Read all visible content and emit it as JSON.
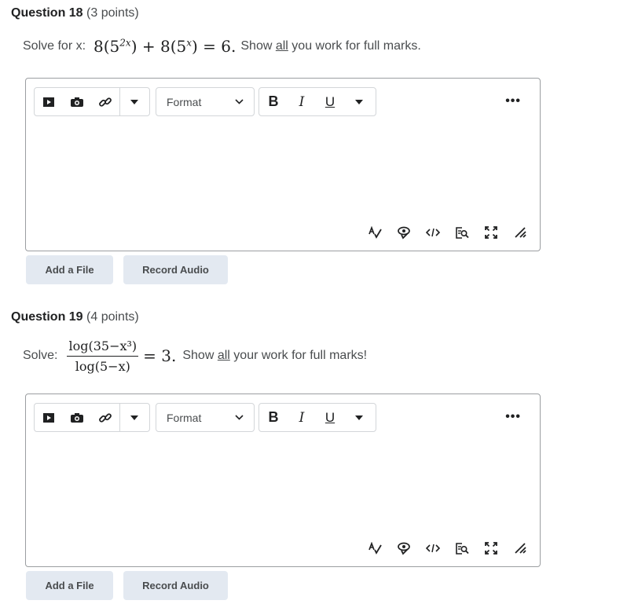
{
  "questions": [
    {
      "label": "Question 18",
      "points": "(3 points)",
      "prompt_prefix": "Solve for x:",
      "math": {
        "c1": "8(5",
        "e1": "2x",
        "mid": ") + 8(5",
        "e2": "x",
        "end": ") = 6."
      },
      "suffix_pre": "Show ",
      "suffix_underline": "all",
      "suffix_post": " you work for full marks."
    },
    {
      "label": "Question 19",
      "points": "(4 points)",
      "prompt_prefix": "Solve:",
      "math": {
        "num": "log(35−x³)",
        "den": "log(5−x)",
        "rhs": "= 3."
      },
      "suffix_pre": "Show ",
      "suffix_underline": "all",
      "suffix_post": " your work for full marks!"
    }
  ],
  "editor": {
    "format_label": "Format",
    "bold_label": "B",
    "italic_label": "I",
    "underline_label": "U",
    "more_label": "•••",
    "icons": [
      "video-icon",
      "camera-icon",
      "link-icon",
      "dropdown-icon",
      "bold-icon",
      "italic-icon",
      "underline-icon",
      "more-icon",
      "spellcheck-icon",
      "accessibility-icon",
      "source-code-icon",
      "preview-icon",
      "fullscreen-icon",
      "resize-handle-icon"
    ]
  },
  "buttons": {
    "add_file": "Add a File",
    "record_audio": "Record Audio"
  },
  "colors": {
    "button_bg": "#e3e9f1",
    "border": "#9b9ea1",
    "text": "#494c4e",
    "heading": "#202122"
  }
}
